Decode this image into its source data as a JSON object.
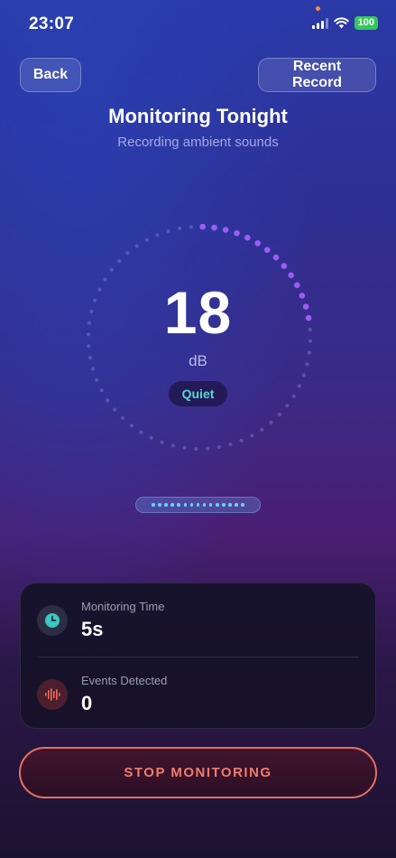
{
  "status_bar": {
    "time": "23:07",
    "battery": "100"
  },
  "header": {
    "back_label": "Back",
    "recent_label": "Recent Record"
  },
  "title": "Monitoring Tonight",
  "subtitle": "Recording ambient sounds",
  "meter": {
    "value": "18",
    "unit": "dB",
    "level": "Quiet",
    "active_dot_count": 14
  },
  "stats": {
    "monitoring_time_label": "Monitoring Time",
    "monitoring_time_value": "5s",
    "events_label": "Events Detected",
    "events_value": "0"
  },
  "stop_label": "STOP MONITORING",
  "colors": {
    "accent_purple": "#9b5cf6",
    "quiet_teal": "#55d6d0",
    "stop_coral": "#f07c6c",
    "battery_green": "#34c759"
  },
  "icons": [
    "signal-icon",
    "wifi-icon",
    "battery-icon",
    "clock-icon",
    "sound-wave-icon"
  ]
}
